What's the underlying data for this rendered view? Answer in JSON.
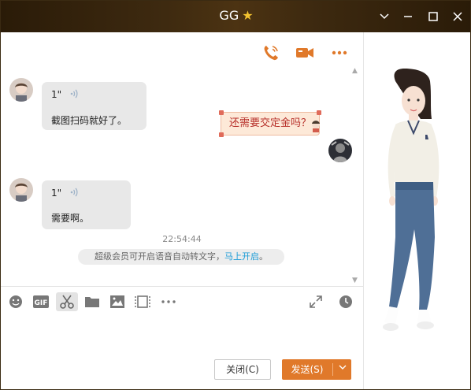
{
  "window": {
    "title": "GG",
    "title_badge_icon": "star-icon",
    "controls": [
      "chevron-down-icon",
      "minimize-icon",
      "maximize-icon",
      "close-icon"
    ]
  },
  "header_actions": [
    "phone-icon",
    "video-camera-icon",
    "more-icon"
  ],
  "messages": [
    {
      "direction": "incoming",
      "voice_duration": "1\"",
      "text": "截图扫码就好了。"
    },
    {
      "direction": "outgoing",
      "text": "还需要交定金吗？"
    },
    {
      "direction": "incoming",
      "voice_duration": "1\"",
      "text": "需要啊。"
    }
  ],
  "timestamp": "22:54:44",
  "notice": {
    "text": "超级会员可开启语音自动转文字，",
    "link": "马上开启",
    "suffix": "。"
  },
  "toolbar": {
    "left": [
      "emoji-icon",
      "gif-icon",
      "scissors-icon",
      "folder-icon",
      "image-icon",
      "video-frame-icon",
      "more-icon"
    ],
    "right": [
      "expand-icon",
      "history-clock-icon"
    ]
  },
  "buttons": {
    "close_label": "关闭(C)",
    "send_label": "发送(S)"
  },
  "colors": {
    "accent": "#e0792a",
    "link": "#1a9bd7",
    "titlebar": "#3e2a10"
  }
}
